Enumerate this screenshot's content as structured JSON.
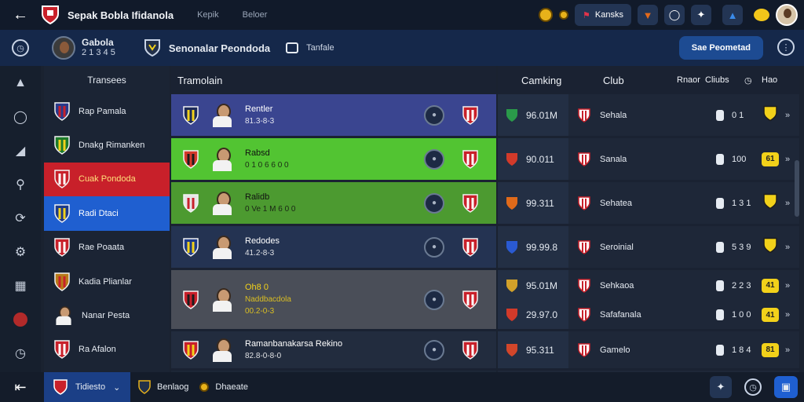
{
  "topbar": {
    "title": "Sepak Bobla Ifidanola",
    "crumb_1": "Kepik",
    "crumb_2": "Beloer",
    "tickets_label": "Kansks",
    "icons": [
      "back-arrow-icon",
      "club-crest-icon",
      "coin-icon",
      "flag-icon",
      "shield-icon",
      "chart-icon",
      "puzzle-icon",
      "trophy-icon",
      "avatar"
    ]
  },
  "subbar": {
    "manager_name": "Gabola",
    "manager_sub": "2 1 3 4 5",
    "team_label": "Senonalar Peondoda",
    "tab_label": "Tanfale",
    "cta_label": "Sae Peometad"
  },
  "sidebar": {
    "header": "Transees",
    "items": [
      {
        "label": "Rap Pamala",
        "state": "normal"
      },
      {
        "label": "Dnakg Rimanken",
        "state": "normal"
      },
      {
        "label": "Cuak Pondoda",
        "state": "red"
      },
      {
        "label": "Radi Dtaci",
        "state": "blue"
      },
      {
        "label": "Rae Poaata",
        "state": "normal"
      },
      {
        "label": "Kadia Plianlar",
        "state": "normal"
      },
      {
        "label": "Nanar Pesta",
        "state": "normal"
      },
      {
        "label": "Ra Afalon",
        "state": "normal"
      }
    ]
  },
  "main": {
    "header": "Tramolain",
    "rows": [
      {
        "name": "Rentler",
        "sub": "81.3-8-3",
        "bg": "#3a4590",
        "color": "#ffffff"
      },
      {
        "name": "Rabsd",
        "sub": "0 1 0 6 6 0 0",
        "bg": "#52c432",
        "color": "#111111"
      },
      {
        "name": "Ralidb",
        "sub": "0 Ve 1 M 6 0 0",
        "bg": "#4c9a30",
        "color": "#111111"
      },
      {
        "name": "Redodes",
        "sub": "41.2-8-3",
        "bg": "#243352",
        "color": "#ffffff"
      },
      {
        "name": "Oh8 0",
        "sub": "Naddbacdola",
        "sub2": "00.2-0-3",
        "bg": "#4a4e58",
        "color": "#f2d11a"
      },
      {
        "name": "Ramanbanakarsa Rekino",
        "sub": "82.8-0-8-0",
        "bg": "#222c3e",
        "color": "#ffffff"
      }
    ]
  },
  "right": {
    "headers": {
      "ranking": "Camking",
      "club": "Club",
      "rank": "Rnaor",
      "clubs": "Cliubs",
      "ho": "Hao"
    },
    "rows": [
      {
        "value": "96.01M",
        "club": "Sehala",
        "num": "0 1",
        "badge": "",
        "flag_color": "#2a9a4a"
      },
      {
        "value": "90.011",
        "club": "Sanala",
        "num": "100",
        "badge": "61",
        "flag_color": "#d23a2a"
      },
      {
        "value": "99.311",
        "club": "Sehatea",
        "num": "1 3 1",
        "badge": "",
        "flag_color": "#e06a1a"
      },
      {
        "value": "99.99.8",
        "club": "Seroinial",
        "num": "5 3 9",
        "badge": "",
        "flag_color": "#2a5ad2"
      },
      {
        "value": "95.01M",
        "club": "Sehkaoa",
        "num": "2 2 3",
        "badge": "41",
        "flag_color": "#d2a12a"
      },
      {
        "value": "29.97.0",
        "club": "Safafanala",
        "num": "1 0 0",
        "badge": "41",
        "flag_color": "#d23a2a"
      },
      {
        "value": "95.311",
        "club": "Gamelo",
        "num": "1 8 4",
        "badge": "81",
        "flag_color": "#d2462a"
      }
    ]
  },
  "bottombar": {
    "select_label": "Tidiesto",
    "tab_1": "Benlaog",
    "tab_2": "Dhaeate"
  },
  "colors": {
    "accent_blue": "#1f5fd0",
    "selected_red": "#c8202a",
    "badge_yellow": "#f2d11a",
    "header_bg": "#111a2a"
  }
}
